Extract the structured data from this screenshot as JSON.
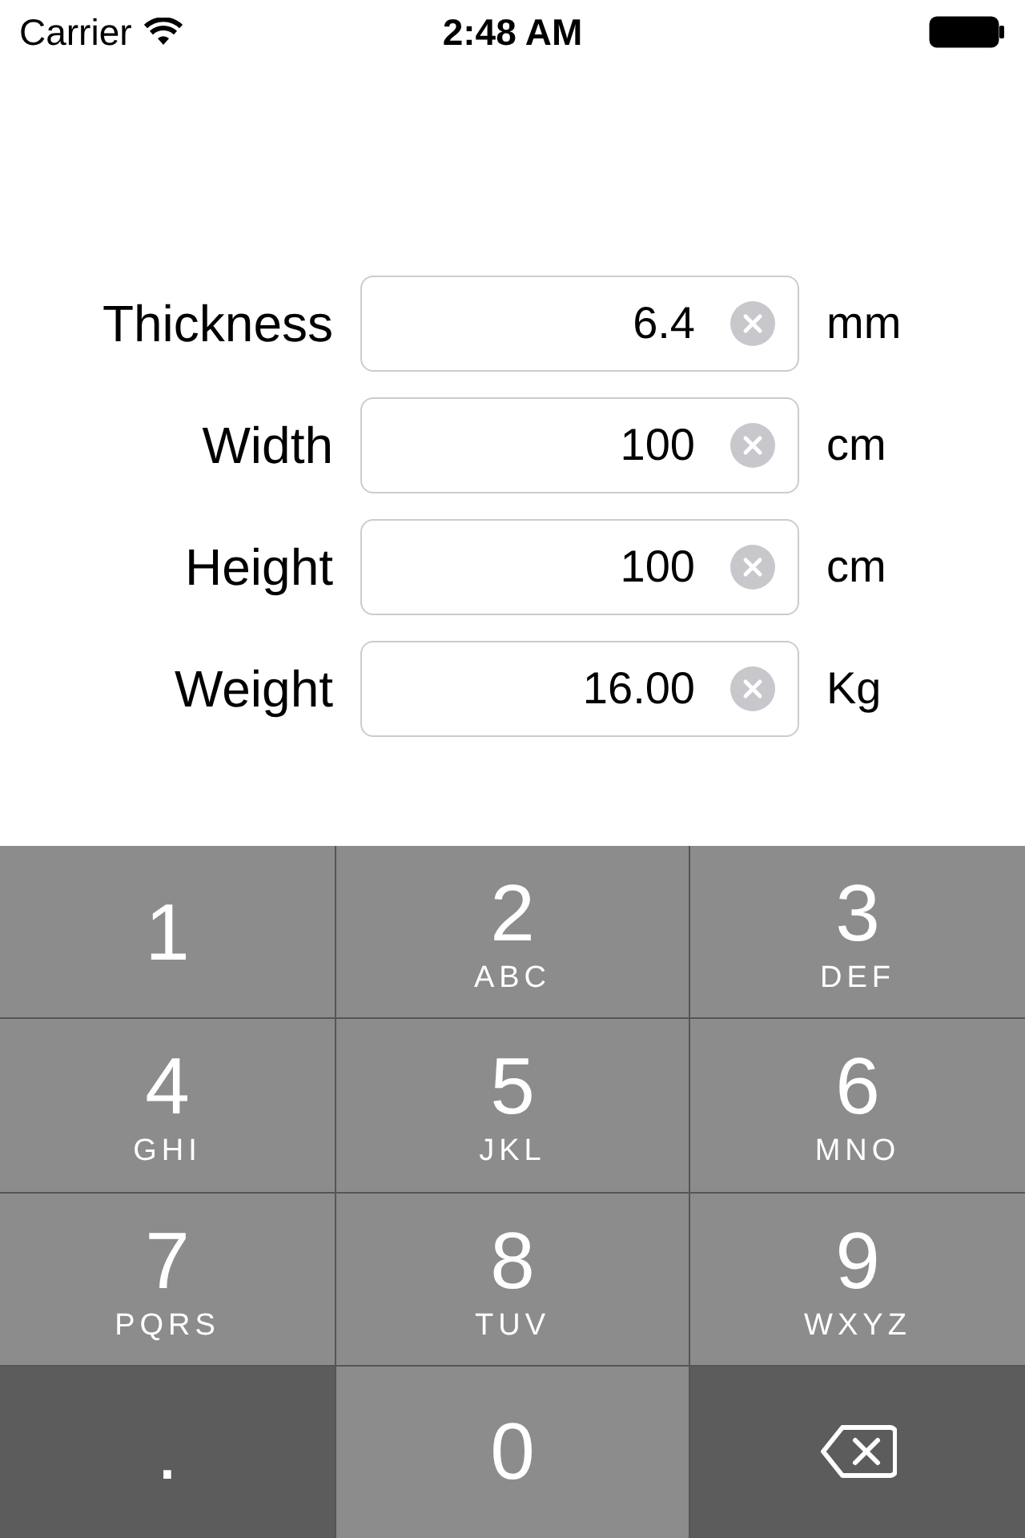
{
  "status_bar": {
    "carrier": "Carrier",
    "time": "2:48 AM"
  },
  "fields": [
    {
      "label": "Thickness",
      "value": "6.4",
      "unit": "mm"
    },
    {
      "label": "Width",
      "value": "100",
      "unit": "cm"
    },
    {
      "label": "Height",
      "value": "100",
      "unit": "cm"
    },
    {
      "label": "Weight",
      "value": "16.00",
      "unit": "Kg"
    }
  ],
  "keypad": [
    {
      "kind": "digit",
      "digit": "1"
    },
    {
      "kind": "digit",
      "digit": "2",
      "letters": "ABC"
    },
    {
      "kind": "digit",
      "digit": "3",
      "letters": "DEF"
    },
    {
      "kind": "digit",
      "digit": "4",
      "letters": "GHI"
    },
    {
      "kind": "digit",
      "digit": "5",
      "letters": "JKL"
    },
    {
      "kind": "digit",
      "digit": "6",
      "letters": "MNO"
    },
    {
      "kind": "digit",
      "digit": "7",
      "letters": "PQRS"
    },
    {
      "kind": "digit",
      "digit": "8",
      "letters": "TUV"
    },
    {
      "kind": "digit",
      "digit": "9",
      "letters": "WXYZ"
    },
    {
      "kind": "decimal",
      "digit": "."
    },
    {
      "kind": "digit",
      "digit": "0"
    },
    {
      "kind": "delete"
    }
  ]
}
